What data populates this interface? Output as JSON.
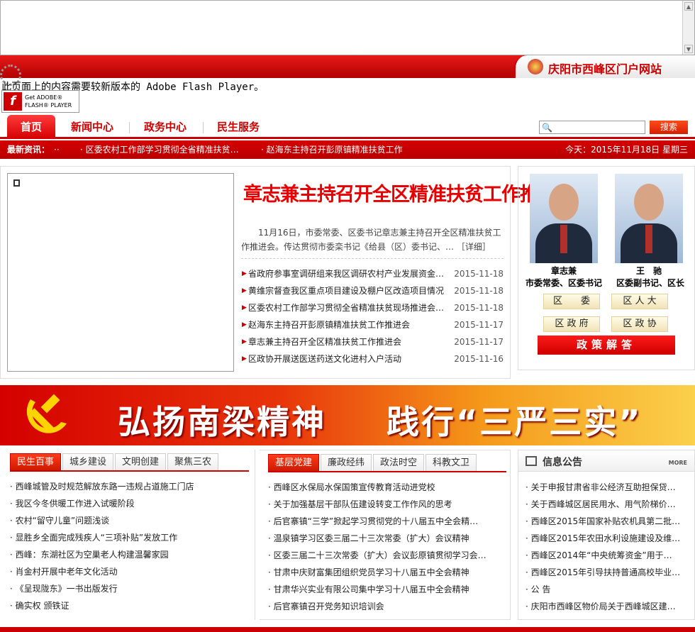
{
  "site": {
    "name": "庆阳市西峰区门户网站"
  },
  "flash": {
    "message": "此页面上的内容需要较新版本的 Adobe Flash Player。",
    "badge_line1": "Get ADOBE®",
    "badge_line2": "FLASH® PLAYER"
  },
  "nav": {
    "tabs": [
      "首页",
      "新闻中心",
      "政务中心",
      "民生服务"
    ],
    "search_placeholder": "",
    "search_button": "搜索"
  },
  "ticker": {
    "label": "最新资讯：",
    "items": [
      "· 区委农村工作部学习贯彻全省精准扶贫…",
      "· 赵海东主持召开彭原镇精准扶贫工作"
    ],
    "date": "今天：2015年11月18日  星期三"
  },
  "headline": {
    "title": "章志兼主持召开全区精准扶贫工作推进会",
    "summary": "11月16日，市委常委、区委书记章志兼主持召开全区精准扶贫工作推进会。传达贯彻市委栾书记《给县（区）委书记、…",
    "detail_link": "［详细］"
  },
  "news": [
    {
      "title": "省政府参事室调研组来我区调研农村产业发展资金…",
      "date": "2015-11-18"
    },
    {
      "title": "黄维宗督查我区重点项目建设及棚户区改造项目情况",
      "date": "2015-11-18"
    },
    {
      "title": "区委农村工作部学习贯彻全省精准扶贫现场推进会…",
      "date": "2015-11-18"
    },
    {
      "title": "赵海东主持召开彭原镇精准扶贫工作推进会",
      "date": "2015-11-17"
    },
    {
      "title": "章志兼主持召开全区精准扶贫工作推进会",
      "date": "2015-11-17"
    },
    {
      "title": "区政协开展送医送药送文化进村入户活动",
      "date": "2015-11-16"
    }
  ],
  "leaders": [
    {
      "name": "章志兼",
      "title": "市委常委、区委书记"
    },
    {
      "name": "王　驰",
      "title": "区委副书记、区长"
    }
  ],
  "orgs": [
    "区　　委",
    "区 人 大",
    "区 政 府",
    "区 政 协"
  ],
  "policy_button": "政策解答",
  "banner": {
    "slogan1": "弘扬南梁精神",
    "slogan2": "践行“三严三实”"
  },
  "left_col": {
    "tabs": [
      "民生百事",
      "城乡建设",
      "文明创建",
      "聚焦三农"
    ],
    "items": [
      "· 西峰城管及时规范解放东路一违规占道施工门店",
      "· 我区今冬供暖工作进入试暖阶段",
      "· 农村“留守儿童”问题浅谈",
      "· 显胜乡全面完成残疾人“三项补贴”发放工作",
      "· 西峰：东湖社区为空巢老人构建温馨家园",
      "· 肖金村开展中老年文化活动",
      "· 《呈现陇东》一书出版发行",
      "· 确实权 颁铁证"
    ]
  },
  "mid_col": {
    "tabs": [
      "基层党建",
      "廉政经纬",
      "政法时空",
      "科教文卫"
    ],
    "items": [
      "· 西峰区水保局水保国策宣传教育活动进党校",
      "· 关于加强基层干部队伍建设转变工作作风的思考",
      "· 后官寨镇“三学”掀起学习贯彻党的十八届五中全会精…",
      "· 温泉镇学习区委三届二十三次常委（扩大）会议精神",
      "· 区委三届二十三次常委（扩大）会议彭原镇贯彻学习会…",
      "· 甘肃中庆财富集团组织党员学习十八届五中全会精神",
      "· 甘肃华兴实业有限公司集中学习十八届五中全会精神",
      "· 后官寨镇召开党务知识培训会"
    ]
  },
  "notice": {
    "title": "信息公告",
    "more": "MORE",
    "items": [
      "· 关于申报甘肃省非公经济互助担保贷…",
      "· 关于西峰城区居民用水、用气阶梯价…",
      "· 西峰区2015年国家补贴农机具第二批…",
      "· 西峰区2015年农田水利设施建设及维…",
      "· 西峰区2014年“中央统筹资金”用于…",
      "· 西峰区2015年引导扶持普通高校毕业…",
      "· 公 告",
      "· 庆阳市西峰区物价局关于西峰城区建…"
    ]
  }
}
